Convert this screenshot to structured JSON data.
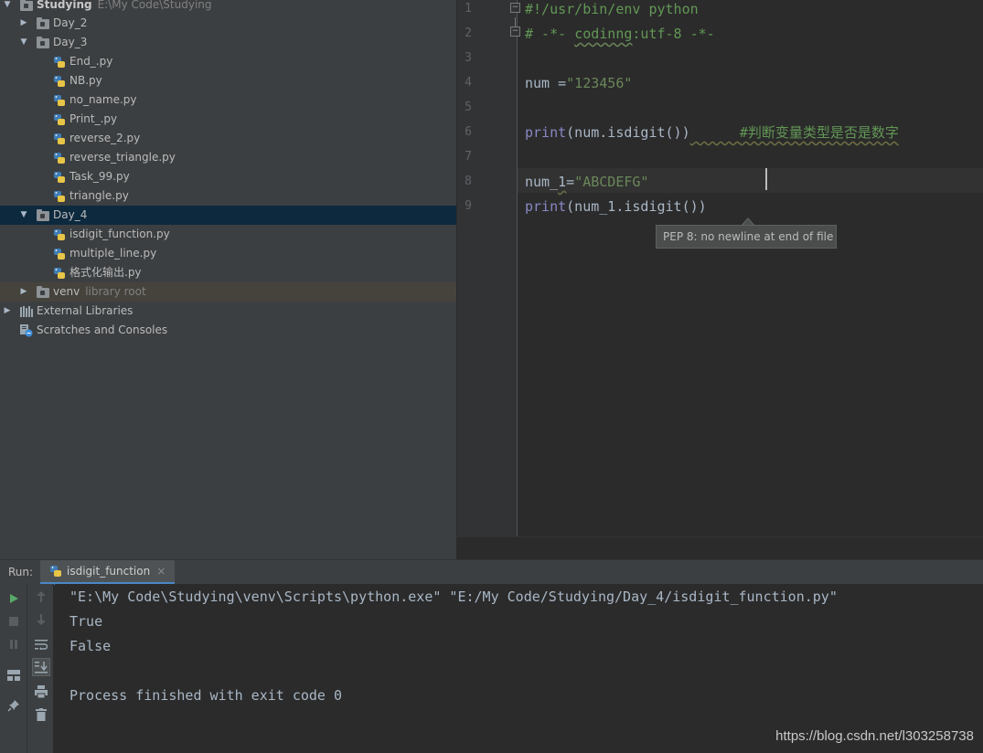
{
  "project_tree": {
    "root": {
      "name": "Studying",
      "path": "E:\\My Code\\Studying"
    },
    "items": [
      {
        "label": "Day_2"
      },
      {
        "label": "Day_3"
      },
      {
        "label": "End_.py"
      },
      {
        "label": "NB.py"
      },
      {
        "label": "no_name.py"
      },
      {
        "label": "Print_.py"
      },
      {
        "label": "reverse_2.py"
      },
      {
        "label": "reverse_triangle.py"
      },
      {
        "label": "Task_99.py"
      },
      {
        "label": "triangle.py"
      },
      {
        "label": "Day_4"
      },
      {
        "label": "isdigit_function.py"
      },
      {
        "label": "multiple_line.py"
      },
      {
        "label": "格式化输出.py"
      },
      {
        "label": "venv",
        "hint": "library root"
      },
      {
        "label": "External Libraries"
      },
      {
        "label": "Scratches and Consoles"
      }
    ]
  },
  "editor": {
    "line_numbers": [
      "1",
      "2",
      "3",
      "4",
      "5",
      "6",
      "7",
      "8",
      "9"
    ],
    "lines": {
      "l1": "#!/usr/bin/env python",
      "l2_a": "# -*- ",
      "l2_b": "codinng",
      "l2_c": ":utf-8 -*-",
      "l4_a": "num =",
      "l4_b": "\"123456\"",
      "l6_a": "print",
      "l6_b": "(num.isdigit())",
      "l6_c": "      ",
      "l6_d": "#判断变量类型是否是数字",
      "l8_a": "num_",
      "l8_b": "1",
      "l8_c": "=",
      "l8_d": "\"ABCDEFG\"",
      "l9_a": "print",
      "l9_b": "(num_1.isdigit())"
    },
    "tooltip": "PEP 8: no newline at end of file"
  },
  "run_panel": {
    "label": "Run:",
    "tab_label": "isdigit_function",
    "tab_close": "×",
    "console_lines": [
      "\"E:\\My Code\\Studying\\venv\\Scripts\\python.exe\" \"E:/My Code/Studying/Day_4/isdigit_function.py\"",
      "True",
      "False",
      "",
      "Process finished with exit code 0"
    ]
  },
  "watermark": "https://blog.csdn.net/l303258738",
  "colors": {
    "accent": "#4a88c7",
    "run_green": "#59a869",
    "selection": "#0d293e"
  }
}
